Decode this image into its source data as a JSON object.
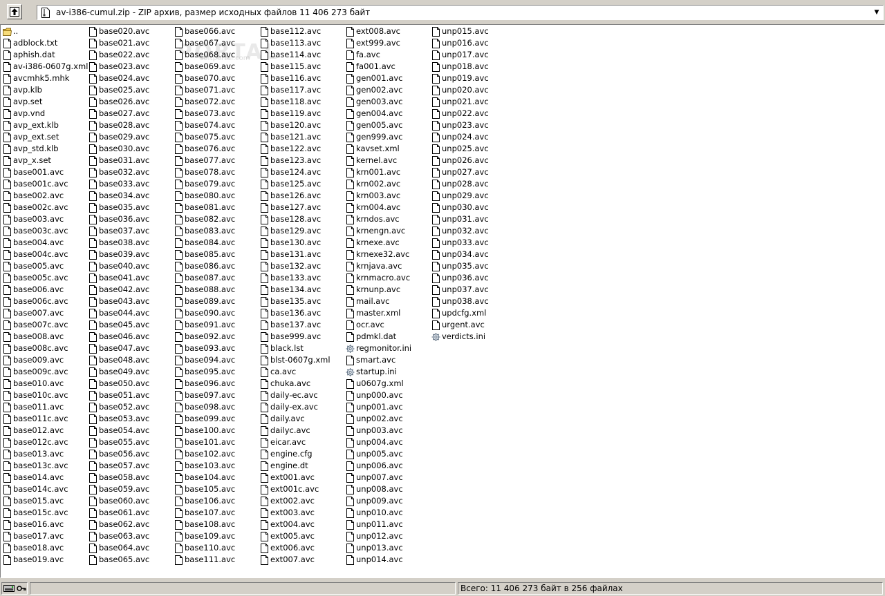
{
  "toolbar": {
    "path": "av-i386-cumul.zip - ZIP архив, размер исходных файлов 11 406 273 байт"
  },
  "files": [
    "..",
    "adblock.txt",
    "aphish.dat",
    "av-i386-0607g.xml",
    "avcmhk5.mhk",
    "avp.klb",
    "avp.set",
    "avp.vnd",
    "avp_ext.klb",
    "avp_ext.set",
    "avp_std.klb",
    "avp_x.set",
    "base001.avc",
    "base001c.avc",
    "base002.avc",
    "base002c.avc",
    "base003.avc",
    "base003c.avc",
    "base004.avc",
    "base004c.avc",
    "base005.avc",
    "base005c.avc",
    "base006.avc",
    "base006c.avc",
    "base007.avc",
    "base007c.avc",
    "base008.avc",
    "base008c.avc",
    "base009.avc",
    "base009c.avc",
    "base010.avc",
    "base010c.avc",
    "base011.avc",
    "base011c.avc",
    "base012.avc",
    "base012c.avc",
    "base013.avc",
    "base013c.avc",
    "base014.avc",
    "base014c.avc",
    "base015.avc",
    "base015c.avc",
    "base016.avc",
    "base017.avc",
    "base018.avc",
    "base019.avc",
    "base020.avc",
    "base021.avc",
    "base022.avc",
    "base023.avc",
    "base024.avc",
    "base025.avc",
    "base026.avc",
    "base027.avc",
    "base028.avc",
    "base029.avc",
    "base030.avc",
    "base031.avc",
    "base032.avc",
    "base033.avc",
    "base034.avc",
    "base035.avc",
    "base036.avc",
    "base037.avc",
    "base038.avc",
    "base039.avc",
    "base040.avc",
    "base041.avc",
    "base042.avc",
    "base043.avc",
    "base044.avc",
    "base045.avc",
    "base046.avc",
    "base047.avc",
    "base048.avc",
    "base049.avc",
    "base050.avc",
    "base051.avc",
    "base052.avc",
    "base053.avc",
    "base054.avc",
    "base055.avc",
    "base056.avc",
    "base057.avc",
    "base058.avc",
    "base059.avc",
    "base060.avc",
    "base061.avc",
    "base062.avc",
    "base063.avc",
    "base064.avc",
    "base065.avc",
    "base066.avc",
    "base067.avc",
    "base068.avc",
    "base069.avc",
    "base070.avc",
    "base071.avc",
    "base072.avc",
    "base073.avc",
    "base074.avc",
    "base075.avc",
    "base076.avc",
    "base077.avc",
    "base078.avc",
    "base079.avc",
    "base080.avc",
    "base081.avc",
    "base082.avc",
    "base083.avc",
    "base084.avc",
    "base085.avc",
    "base086.avc",
    "base087.avc",
    "base088.avc",
    "base089.avc",
    "base090.avc",
    "base091.avc",
    "base092.avc",
    "base093.avc",
    "base094.avc",
    "base095.avc",
    "base096.avc",
    "base097.avc",
    "base098.avc",
    "base099.avc",
    "base100.avc",
    "base101.avc",
    "base102.avc",
    "base103.avc",
    "base104.avc",
    "base105.avc",
    "base106.avc",
    "base107.avc",
    "base108.avc",
    "base109.avc",
    "base110.avc",
    "base111.avc",
    "base112.avc",
    "base113.avc",
    "base114.avc",
    "base115.avc",
    "base116.avc",
    "base117.avc",
    "base118.avc",
    "base119.avc",
    "base120.avc",
    "base121.avc",
    "base122.avc",
    "base123.avc",
    "base124.avc",
    "base125.avc",
    "base126.avc",
    "base127.avc",
    "base128.avc",
    "base129.avc",
    "base130.avc",
    "base131.avc",
    "base132.avc",
    "base133.avc",
    "base134.avc",
    "base135.avc",
    "base136.avc",
    "base137.avc",
    "base999.avc",
    "black.lst",
    "blst-0607g.xml",
    "ca.avc",
    "chuka.avc",
    "daily-ec.avc",
    "daily-ex.avc",
    "daily.avc",
    "dailyc.avc",
    "eicar.avc",
    "engine.cfg",
    "engine.dt",
    "ext001.avc",
    "ext001c.avc",
    "ext002.avc",
    "ext003.avc",
    "ext004.avc",
    "ext005.avc",
    "ext006.avc",
    "ext007.avc",
    "ext008.avc",
    "ext999.avc",
    "fa.avc",
    "fa001.avc",
    "gen001.avc",
    "gen002.avc",
    "gen003.avc",
    "gen004.avc",
    "gen005.avc",
    "gen999.avc",
    "kavset.xml",
    "kernel.avc",
    "krn001.avc",
    "krn002.avc",
    "krn003.avc",
    "krn004.avc",
    "krndos.avc",
    "krnengn.avc",
    "krnexe.avc",
    "krnexe32.avc",
    "krnjava.avc",
    "krnmacro.avc",
    "krnunp.avc",
    "mail.avc",
    "master.xml",
    "ocr.avc",
    "pdmkl.dat",
    "regmonitor.ini",
    "smart.avc",
    "startup.ini",
    "u0607g.xml",
    "unp000.avc",
    "unp001.avc",
    "unp002.avc",
    "unp003.avc",
    "unp004.avc",
    "unp005.avc",
    "unp006.avc",
    "unp007.avc",
    "unp008.avc",
    "unp009.avc",
    "unp010.avc",
    "unp011.avc",
    "unp012.avc",
    "unp013.avc",
    "unp014.avc",
    "unp015.avc",
    "unp016.avc",
    "unp017.avc",
    "unp018.avc",
    "unp019.avc",
    "unp020.avc",
    "unp021.avc",
    "unp022.avc",
    "unp023.avc",
    "unp024.avc",
    "unp025.avc",
    "unp026.avc",
    "unp027.avc",
    "unp028.avc",
    "unp029.avc",
    "unp030.avc",
    "unp031.avc",
    "unp032.avc",
    "unp033.avc",
    "unp034.avc",
    "unp035.avc",
    "unp036.avc",
    "unp037.avc",
    "unp038.avc",
    "updcfg.xml",
    "urgent.avc",
    "verdicts.ini"
  ],
  "icons": {
    "folder": "folder-up-icon",
    "file": "file-icon",
    "config": "settings-file-icon"
  },
  "watermark": {
    "title": "PORTAL",
    "sub": "softportal.com"
  },
  "status": {
    "summary": "Всего: 11 406 273 байт в 256 файлах"
  }
}
